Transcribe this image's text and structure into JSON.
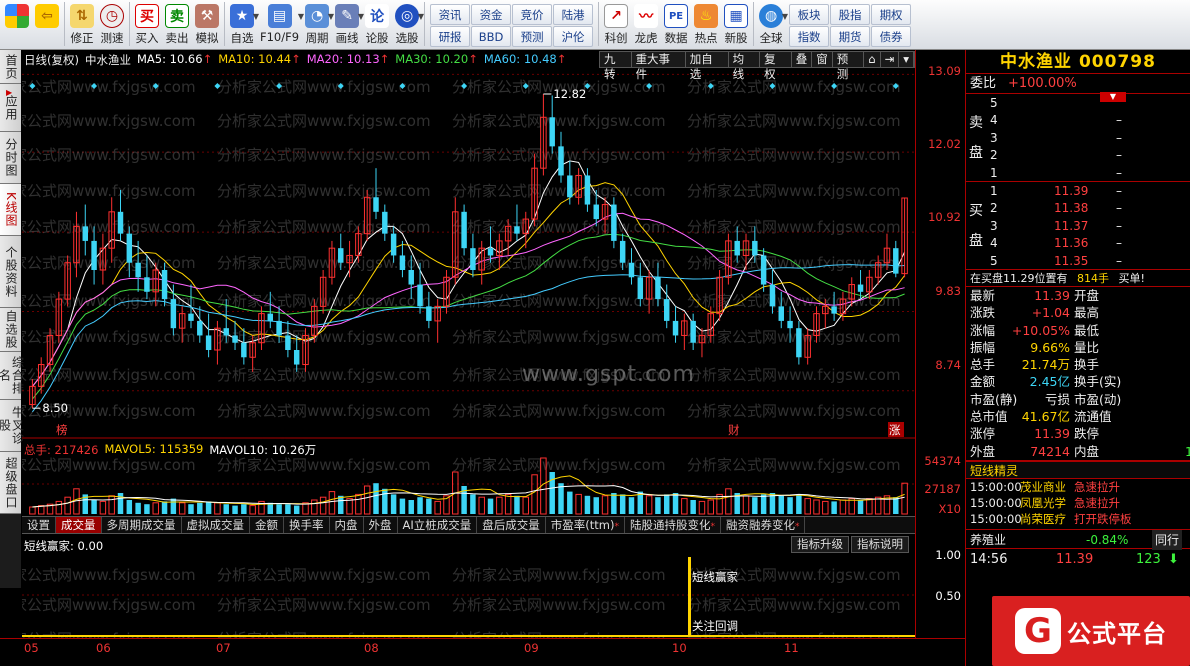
{
  "toolbar": {
    "buttons": [
      {
        "id": "home",
        "label": "",
        "icon": "windows-grid-icon"
      },
      {
        "id": "back",
        "label": "",
        "icon": "back-arrow-icon"
      },
      {
        "id": "modify",
        "label": "修正",
        "icon": "up-down-arrows-icon"
      },
      {
        "id": "test",
        "label": "测速",
        "icon": "stopwatch-icon"
      },
      {
        "id": "buy",
        "label": "买入",
        "icon": "buy-icon",
        "glyph": "买"
      },
      {
        "id": "sell",
        "label": "卖出",
        "icon": "sell-icon",
        "glyph": "卖"
      },
      {
        "id": "simulate",
        "label": "模拟",
        "icon": "gavel-icon"
      },
      {
        "id": "watchlist",
        "label": "自选",
        "icon": "star-icon"
      },
      {
        "id": "f10",
        "label": "F10/F9",
        "icon": "f10-icon"
      },
      {
        "id": "period",
        "label": "周期",
        "icon": "period-icon"
      },
      {
        "id": "drawline",
        "label": "画线",
        "icon": "pencil-icon"
      },
      {
        "id": "lungu",
        "label": "论股",
        "icon": "lungu-icon",
        "glyph": "论"
      },
      {
        "id": "pickstock",
        "label": "选股",
        "icon": "radar-icon"
      }
    ],
    "grid1": [
      "资讯",
      "研报",
      "资金",
      "BBD",
      "竞价",
      "预测",
      "陆港",
      "沪伦"
    ],
    "buttons2": [
      {
        "id": "kecheng",
        "label": "科创",
        "icon": "chart-icon"
      },
      {
        "id": "longhu",
        "label": "龙虎",
        "icon": "dragon-icon"
      },
      {
        "id": "shuju",
        "label": "数据",
        "icon": "pe-icon",
        "glyph": "PE"
      },
      {
        "id": "redian",
        "label": "热点",
        "icon": "fire-icon"
      },
      {
        "id": "xingu",
        "label": "新股",
        "icon": "new-stock-icon"
      },
      {
        "id": "quanqiu",
        "label": "全球",
        "icon": "globe-icon"
      }
    ],
    "grid2": [
      "板块",
      "指数",
      "股指",
      "期货",
      "期权",
      "债券"
    ]
  },
  "left_tabs": [
    {
      "label": "首页",
      "active": false
    },
    {
      "label": "应用",
      "active": false,
      "arrow": true
    },
    {
      "label": "分时图",
      "active": false
    },
    {
      "label": "K线图",
      "active": true
    },
    {
      "label": "个股资料",
      "active": false
    },
    {
      "label": "自选股",
      "active": false
    },
    {
      "label": "综合排名",
      "active": false
    },
    {
      "label": "牛叉诊股",
      "active": false
    },
    {
      "label": "超级盘口",
      "active": false
    }
  ],
  "chart_header": {
    "label": "日线(复权)",
    "name": "中水渔业",
    "ma": [
      {
        "name": "MA5",
        "value": "10.66",
        "color": "#ffffff"
      },
      {
        "name": "MA10",
        "value": "10.44",
        "color": "#ffd400"
      },
      {
        "name": "MA20",
        "value": "10.13",
        "color": "#ff66ff"
      },
      {
        "name": "MA30",
        "value": "10.20",
        "color": "#44dd44"
      },
      {
        "name": "MA60",
        "value": "10.48",
        "color": "#44ccff"
      }
    ],
    "tools": [
      "九转",
      "重大事件",
      "加自选",
      "均线",
      "复权",
      "叠",
      "窗",
      "预测",
      "⌂",
      "⇥",
      "▾"
    ]
  },
  "price_axis": {
    "labels": [
      "13.09",
      "12.02",
      "10.92",
      "9.83",
      "8.74"
    ],
    "values": [
      13.09,
      12.02,
      10.92,
      9.83,
      8.74
    ]
  },
  "annotations": {
    "high": "12.82",
    "low": "8.50",
    "bang": "榜",
    "cai": "财",
    "zhang": "涨"
  },
  "volume": {
    "label": "总手: 217426",
    "mavol5": "MAVOL5: 115359",
    "mavol10": "MAVOL10: 10.26万",
    "axis": [
      "54374",
      "27187",
      "X10"
    ]
  },
  "indicator_tabs": [
    {
      "label": "设置",
      "active": false
    },
    {
      "label": "成交量",
      "active": true
    },
    {
      "label": "多周期成交量",
      "active": false
    },
    {
      "label": "虚拟成交量",
      "active": false
    },
    {
      "label": "金额",
      "active": false
    },
    {
      "label": "换手率",
      "active": false
    },
    {
      "label": "内盘",
      "active": false
    },
    {
      "label": "外盘",
      "active": false
    },
    {
      "label": "AI立桩成交量",
      "active": false
    },
    {
      "label": "盘后成交量",
      "active": false
    },
    {
      "label": "市盈率(ttm)",
      "active": false,
      "star": true
    },
    {
      "label": "陆股通持股变化",
      "active": false,
      "star": true
    },
    {
      "label": "融资融券变化",
      "active": false,
      "star": true
    }
  ],
  "indicator": {
    "label": "短线赢家: 0.00",
    "buttons": [
      "指标升级",
      "指标说明"
    ],
    "axis": [
      "1.00",
      "0.50"
    ],
    "tag1": "短线赢家",
    "tag2": "关注回调"
  },
  "dates": [
    "05",
    "06",
    "07",
    "08",
    "09",
    "10",
    "11"
  ],
  "watermarks": {
    "site": "分析家公式网www.fxjgsw.com",
    "gspt": "www.gspt.com"
  },
  "stock": {
    "name": "中水渔业",
    "code": "000798"
  },
  "orderbook": {
    "weibi_label": "委比",
    "weibi": "+100.00%",
    "sell_side": "卖盘",
    "buy_side": "买盘",
    "sell": [
      {
        "lv": "5",
        "p": "",
        "v": ""
      },
      {
        "lv": "4",
        "p": "",
        "v": "–"
      },
      {
        "lv": "3",
        "p": "",
        "v": "–"
      },
      {
        "lv": "2",
        "p": "",
        "v": "–"
      },
      {
        "lv": "1",
        "p": "",
        "v": "–"
      }
    ],
    "buy": [
      {
        "lv": "1",
        "p": "11.39",
        "v": "–"
      },
      {
        "lv": "2",
        "p": "11.38",
        "v": "–"
      },
      {
        "lv": "3",
        "p": "11.37",
        "v": "–"
      },
      {
        "lv": "4",
        "p": "11.36",
        "v": "–"
      },
      {
        "lv": "5",
        "p": "11.35",
        "v": "–"
      }
    ],
    "note": "在买盘11.29位置有",
    "note_vol": "814手",
    "note_tag": "买单!"
  },
  "quote": [
    {
      "l1": "最新",
      "v1": "11.39",
      "c1": "red",
      "l2": "开盘",
      "v2": ""
    },
    {
      "l1": "涨跌",
      "v1": "+1.04",
      "c1": "red",
      "l2": "最高",
      "v2": ""
    },
    {
      "l1": "涨幅",
      "v1": "+10.05%",
      "c1": "red",
      "l2": "最低",
      "v2": ""
    },
    {
      "l1": "振幅",
      "v1": "9.66%",
      "c1": "yel",
      "l2": "量比",
      "v2": ""
    },
    {
      "l1": "总手",
      "v1": "21.74万",
      "c1": "yel",
      "l2": "换手",
      "v2": ""
    },
    {
      "l1": "金额",
      "v1": "2.45亿",
      "c1": "cyan",
      "l2": "换手(实)",
      "v2": ""
    },
    {
      "l1": "市盈(静)",
      "v1": "亏损",
      "c1": "wht",
      "l2": "市盈(动)",
      "v2": ""
    },
    {
      "l1": "总市值",
      "v1": "41.67亿",
      "c1": "yel",
      "l2": "流通值",
      "v2": ""
    },
    {
      "l1": "涨停",
      "v1": "11.39",
      "c1": "red",
      "l2": "跌停",
      "v2": ""
    },
    {
      "l1": "外盘",
      "v1": "74214",
      "c1": "red",
      "l2": "内盘",
      "v2": "1"
    }
  ],
  "wizard": {
    "title": "短线精灵",
    "items": [
      {
        "t": "15:00:00",
        "n": "茂业商业",
        "e": "急速拉升"
      },
      {
        "t": "15:00:00",
        "n": "凤凰光学",
        "e": "急速拉升"
      },
      {
        "t": "15:00:00",
        "n": "尚荣医疗",
        "e": "打开跌停板"
      }
    ]
  },
  "sector": {
    "name": "养殖业",
    "change": "-0.84%",
    "tab": "同行"
  },
  "tick": {
    "time": "14:56",
    "price": "11.39",
    "vol": "123"
  },
  "logo": {
    "text": "公式平台",
    "glyph": "G"
  },
  "colors": {
    "up": "#ff3030",
    "down": "#3dd5f5",
    "panel_border": "#aa0000",
    "stock_title": "#ffd400"
  },
  "chart_data": {
    "type": "candlestick",
    "ylim": [
      8.2,
      13.15
    ],
    "ohlc": [
      [
        8.55,
        8.9,
        8.5,
        8.8
      ],
      [
        8.8,
        9.2,
        8.7,
        9.1
      ],
      [
        9.1,
        9.6,
        9.0,
        9.5
      ],
      [
        9.5,
        10.1,
        9.4,
        10.0
      ],
      [
        10.0,
        10.6,
        9.9,
        10.5
      ],
      [
        10.5,
        11.2,
        10.3,
        11.0
      ],
      [
        11.0,
        11.3,
        10.6,
        10.8
      ],
      [
        10.8,
        11.0,
        10.2,
        10.4
      ],
      [
        10.4,
        10.9,
        10.2,
        10.7
      ],
      [
        10.7,
        11.4,
        10.5,
        11.2
      ],
      [
        11.2,
        11.5,
        10.8,
        10.9
      ],
      [
        10.9,
        11.0,
        10.3,
        10.5
      ],
      [
        10.5,
        10.8,
        10.1,
        10.3
      ],
      [
        10.3,
        10.6,
        10.0,
        10.1
      ],
      [
        10.1,
        10.5,
        9.9,
        10.4
      ],
      [
        10.4,
        10.5,
        9.9,
        10.0
      ],
      [
        10.0,
        10.2,
        9.5,
        9.6
      ],
      [
        9.6,
        9.9,
        9.4,
        9.8
      ],
      [
        9.8,
        10.2,
        9.6,
        9.7
      ],
      [
        9.7,
        9.9,
        9.4,
        9.5
      ],
      [
        9.5,
        9.8,
        9.2,
        9.3
      ],
      [
        9.3,
        9.7,
        9.1,
        9.6
      ],
      [
        9.6,
        10.0,
        9.4,
        9.5
      ],
      [
        9.5,
        9.7,
        9.3,
        9.4
      ],
      [
        9.4,
        9.6,
        9.1,
        9.2
      ],
      [
        9.2,
        9.5,
        9.0,
        9.4
      ],
      [
        9.4,
        9.9,
        9.3,
        9.8
      ],
      [
        9.8,
        10.1,
        9.6,
        9.7
      ],
      [
        9.7,
        9.9,
        9.4,
        9.5
      ],
      [
        9.5,
        9.7,
        9.2,
        9.3
      ],
      [
        9.3,
        9.5,
        9.0,
        9.1
      ],
      [
        9.1,
        9.6,
        9.0,
        9.5
      ],
      [
        9.5,
        10.0,
        9.4,
        9.9
      ],
      [
        9.9,
        10.4,
        9.8,
        10.3
      ],
      [
        10.3,
        10.8,
        10.2,
        10.7
      ],
      [
        10.7,
        10.9,
        10.4,
        10.5
      ],
      [
        10.5,
        10.8,
        10.3,
        10.6
      ],
      [
        10.6,
        11.0,
        10.5,
        10.9
      ],
      [
        10.9,
        11.5,
        10.8,
        11.4
      ],
      [
        11.4,
        11.8,
        11.1,
        11.2
      ],
      [
        11.2,
        11.3,
        10.8,
        10.9
      ],
      [
        10.9,
        11.0,
        10.5,
        10.6
      ],
      [
        10.6,
        10.8,
        10.3,
        10.4
      ],
      [
        10.4,
        10.6,
        10.0,
        10.2
      ],
      [
        10.2,
        10.5,
        9.8,
        9.9
      ],
      [
        9.9,
        10.1,
        9.6,
        9.7
      ],
      [
        9.7,
        10.0,
        9.4,
        9.9
      ],
      [
        9.9,
        10.4,
        9.8,
        10.3
      ],
      [
        10.3,
        11.4,
        10.2,
        11.2
      ],
      [
        11.2,
        11.3,
        10.6,
        10.7
      ],
      [
        10.7,
        10.9,
        10.3,
        10.4
      ],
      [
        10.4,
        10.8,
        10.2,
        10.7
      ],
      [
        10.7,
        11.0,
        10.5,
        10.6
      ],
      [
        10.6,
        10.9,
        10.4,
        10.8
      ],
      [
        10.8,
        11.1,
        10.6,
        11.0
      ],
      [
        11.0,
        11.3,
        10.8,
        10.9
      ],
      [
        10.9,
        11.2,
        10.7,
        11.1
      ],
      [
        11.1,
        12.0,
        11.0,
        11.8
      ],
      [
        11.8,
        12.82,
        11.7,
        12.5
      ],
      [
        12.5,
        12.8,
        12.0,
        12.1
      ],
      [
        12.1,
        12.3,
        11.6,
        11.7
      ],
      [
        11.7,
        11.9,
        11.3,
        11.4
      ],
      [
        11.4,
        11.8,
        11.3,
        11.7
      ],
      [
        11.7,
        11.8,
        11.2,
        11.3
      ],
      [
        11.3,
        11.5,
        11.0,
        11.1
      ],
      [
        11.1,
        11.4,
        10.9,
        11.3
      ],
      [
        11.3,
        11.4,
        10.7,
        10.8
      ],
      [
        10.8,
        10.9,
        10.4,
        10.5
      ],
      [
        10.5,
        10.7,
        10.2,
        10.3
      ],
      [
        10.3,
        10.5,
        9.9,
        10.0
      ],
      [
        10.0,
        10.4,
        9.8,
        10.3
      ],
      [
        10.3,
        10.5,
        9.9,
        10.0
      ],
      [
        10.0,
        10.2,
        9.6,
        9.7
      ],
      [
        9.7,
        9.9,
        9.4,
        9.5
      ],
      [
        9.5,
        9.8,
        9.3,
        9.7
      ],
      [
        9.7,
        9.8,
        9.3,
        9.4
      ],
      [
        9.4,
        9.6,
        9.2,
        9.5
      ],
      [
        9.5,
        9.9,
        9.4,
        9.8
      ],
      [
        9.8,
        10.4,
        9.7,
        10.3
      ],
      [
        10.3,
        10.9,
        10.2,
        10.8
      ],
      [
        10.8,
        11.0,
        10.5,
        10.6
      ],
      [
        10.6,
        10.9,
        10.4,
        10.8
      ],
      [
        10.8,
        11.0,
        10.5,
        10.6
      ],
      [
        10.6,
        10.7,
        10.1,
        10.2
      ],
      [
        10.2,
        10.4,
        9.8,
        9.9
      ],
      [
        9.9,
        10.1,
        9.6,
        9.7
      ],
      [
        9.7,
        9.9,
        9.4,
        9.6
      ],
      [
        9.6,
        9.7,
        9.1,
        9.2
      ],
      [
        9.2,
        9.6,
        9.1,
        9.5
      ],
      [
        9.5,
        9.9,
        9.4,
        9.8
      ],
      [
        9.8,
        10.0,
        9.6,
        9.9
      ],
      [
        9.9,
        10.1,
        9.7,
        9.8
      ],
      [
        9.8,
        10.1,
        9.7,
        10.0
      ],
      [
        10.0,
        10.3,
        9.9,
        10.2
      ],
      [
        10.2,
        10.4,
        10.0,
        10.1
      ],
      [
        10.1,
        10.4,
        10.0,
        10.3
      ],
      [
        10.3,
        10.6,
        10.2,
        10.5
      ],
      [
        10.5,
        10.9,
        10.4,
        10.7
      ],
      [
        10.7,
        10.8,
        10.3,
        10.35
      ],
      [
        10.35,
        11.39,
        10.3,
        11.39
      ]
    ],
    "volume": [
      5,
      6,
      7,
      9,
      12,
      18,
      14,
      10,
      9,
      13,
      15,
      10,
      8,
      7,
      8,
      9,
      11,
      8,
      7,
      8,
      9,
      8,
      7,
      6,
      7,
      6,
      9,
      8,
      7,
      7,
      6,
      8,
      10,
      12,
      16,
      13,
      11,
      14,
      20,
      22,
      18,
      14,
      11,
      10,
      12,
      11,
      9,
      13,
      30,
      20,
      14,
      12,
      11,
      12,
      14,
      13,
      12,
      28,
      40,
      30,
      22,
      16,
      14,
      13,
      12,
      13,
      15,
      14,
      12,
      16,
      13,
      12,
      14,
      15,
      11,
      10,
      9,
      10,
      14,
      18,
      15,
      13,
      12,
      14,
      15,
      13,
      12,
      14,
      11,
      10,
      9,
      9,
      10,
      11,
      10,
      11,
      12,
      13,
      12,
      22
    ]
  }
}
